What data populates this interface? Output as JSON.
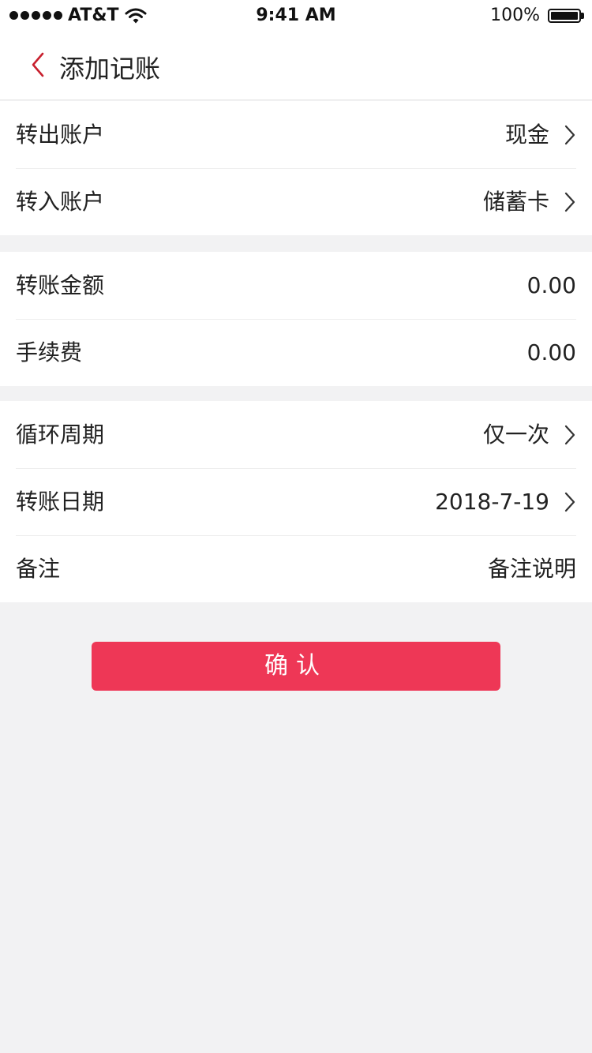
{
  "status_bar": {
    "carrier": "AT&T",
    "time": "9:41 AM",
    "battery": "100%"
  },
  "nav": {
    "title": "添加记账"
  },
  "groups": [
    {
      "rows": [
        {
          "label": "转出账户",
          "value": "现金",
          "chevron": true
        },
        {
          "label": "转入账户",
          "value": "储蓄卡",
          "chevron": true
        }
      ]
    },
    {
      "rows": [
        {
          "label": "转账金额",
          "value": "0.00",
          "chevron": false
        },
        {
          "label": "手续费",
          "value": "0.00",
          "chevron": false
        }
      ]
    },
    {
      "rows": [
        {
          "label": "循环周期",
          "value": "仅一次",
          "chevron": true
        },
        {
          "label": "转账日期",
          "value": "2018-7-19",
          "chevron": true
        },
        {
          "label": "备注",
          "value": "备注说明",
          "chevron": false
        }
      ]
    }
  ],
  "confirm_label": "确认",
  "colors": {
    "accent": "#ee3756",
    "back": "#c8202e",
    "background": "#f2f2f3"
  }
}
